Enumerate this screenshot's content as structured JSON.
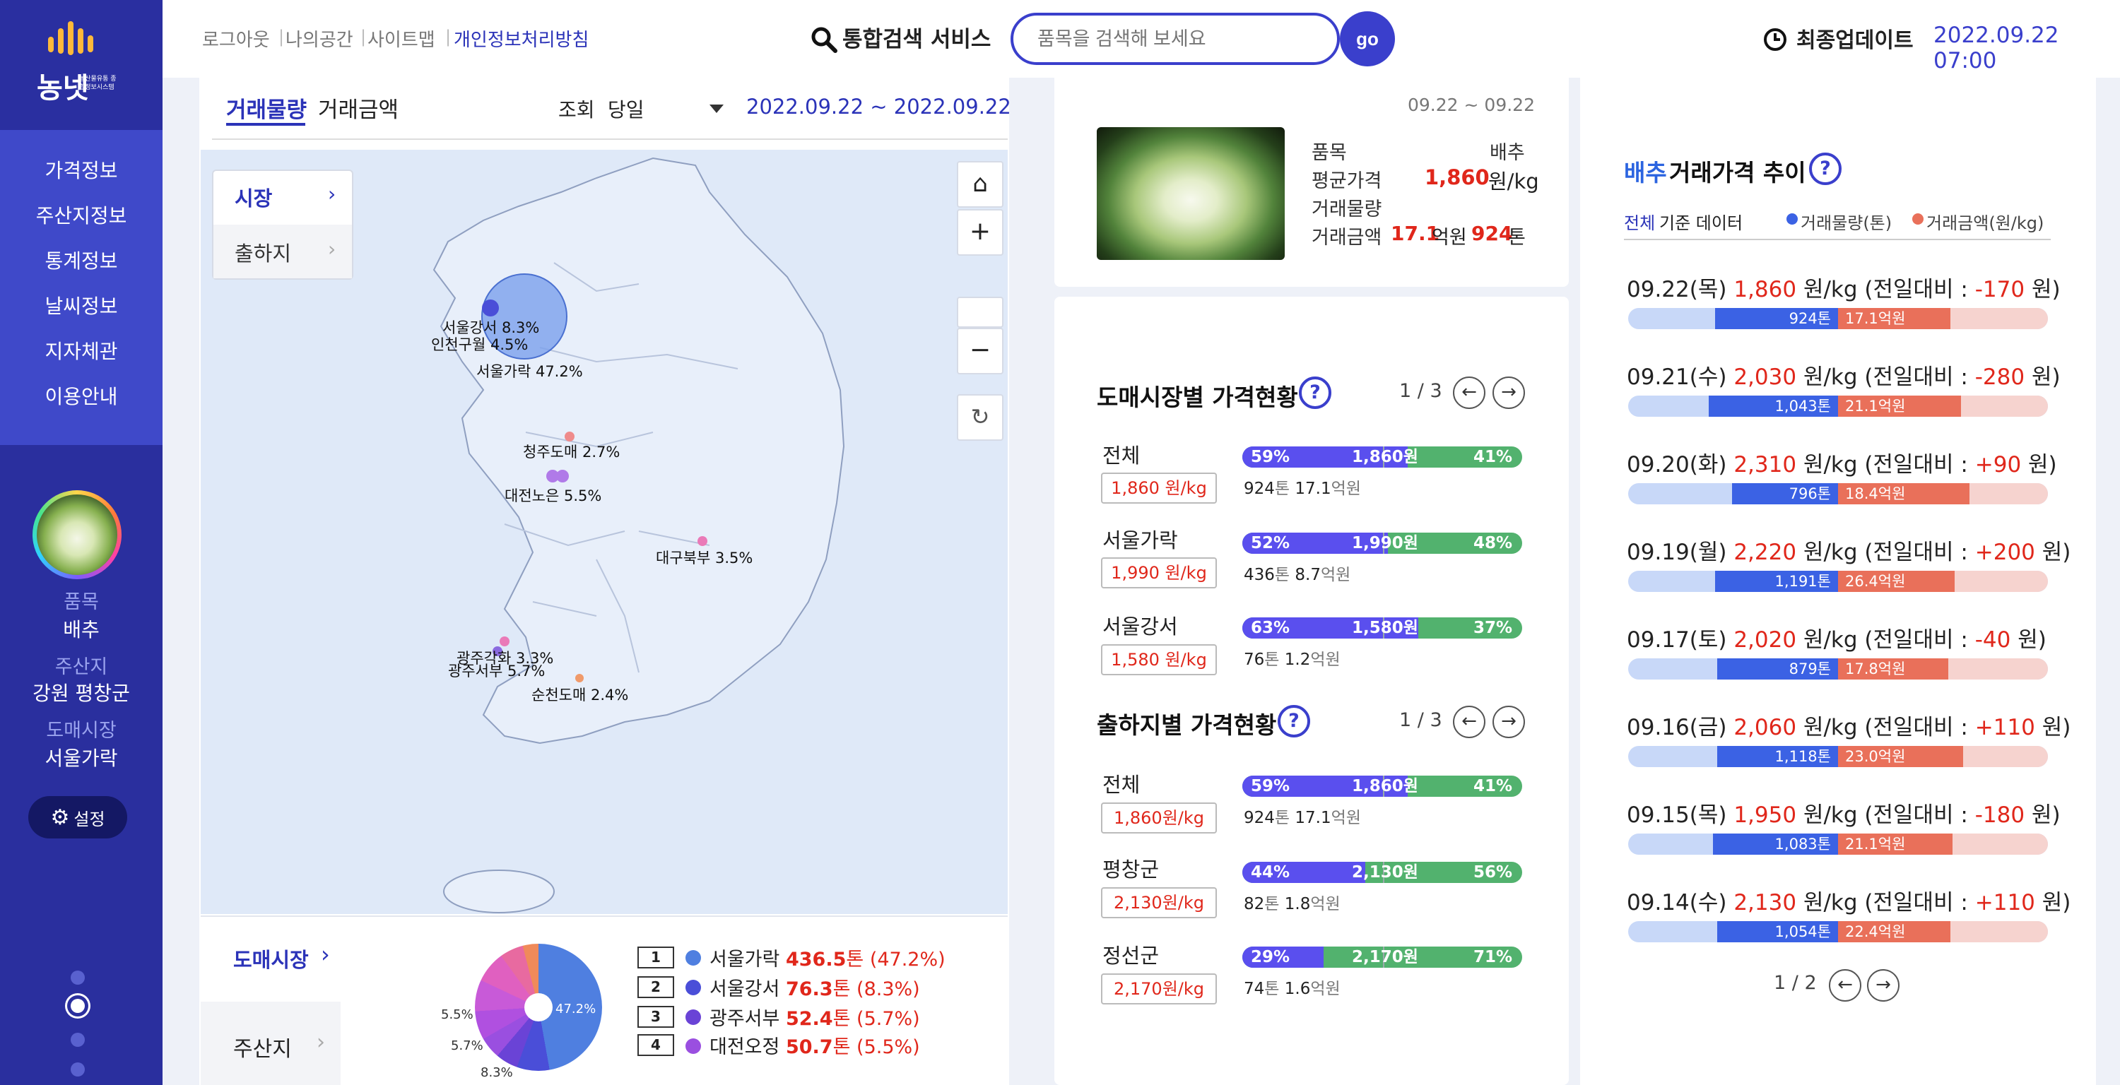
{
  "colors": {
    "primary": "#3a3fcc",
    "sidebar": "#3038b0",
    "price_red": "#e0271b",
    "bar_purple": "#5a4fee",
    "bar_green": "#52b26e",
    "vol_blue": "#3b62e4",
    "amt_red": "#e9705a"
  },
  "logo": {
    "text": "농넷",
    "sub": "농산물유통 종합정보시스템"
  },
  "sidebar": {
    "nav": [
      "가격정보",
      "주산지정보",
      "통계정보",
      "날씨정보",
      "지자체관",
      "이용안내"
    ],
    "profile": {
      "item_label": "품목",
      "item_value": "배추",
      "origin_label": "주산지",
      "origin_value": "강원 평창군",
      "market_label": "도매시장",
      "market_value": "서울가락"
    },
    "settings_label": "설정"
  },
  "header": {
    "links": [
      "로그아웃",
      "나의공간",
      "사이트맵",
      "개인정보처리방침"
    ],
    "search_label": "통합검색 서비스",
    "search_placeholder": "품목을 검색해 보세요",
    "go_label": "go",
    "update_label": "최종업데이트",
    "update_time": "2022.09.22 07:00"
  },
  "left": {
    "tabs": [
      "거래물량",
      "거래금액"
    ],
    "query_label": "조회",
    "query_value": "당일",
    "date_range": "2022.09.22 ~ 2022.09.22",
    "map_tabs": [
      "시장",
      "출하지"
    ],
    "map_labels": [
      "서울강서 8.3%",
      "인천구월 4.5%",
      "서울가락 47.2%",
      "청주도매 2.7%",
      "대전노은 5.5%",
      "대구북부 3.5%",
      "광주각화 3.3%",
      "광주서부 5.7%",
      "순천도매 2.4%"
    ],
    "bottom_tabs": [
      "도매시장",
      "주산지"
    ],
    "pie_labels": [
      "47.2%",
      "5.5%",
      "5.7%",
      "8.3%"
    ],
    "legend": [
      {
        "rank": "1",
        "name": "서울가락",
        "value": "436.5",
        "unit": "톤",
        "pct": "(47.2%)",
        "color": "#4f7fe0"
      },
      {
        "rank": "2",
        "name": "서울강서",
        "value": "76.3",
        "unit": "톤",
        "pct": "(8.3%)",
        "color": "#4a4ed8"
      },
      {
        "rank": "3",
        "name": "광주서부",
        "value": "52.4",
        "unit": "톤",
        "pct": "(5.7%)",
        "color": "#6a43d6"
      },
      {
        "rank": "4",
        "name": "대전오정",
        "value": "50.7",
        "unit": "톤",
        "pct": "(5.5%)",
        "color": "#9a4fe0"
      }
    ]
  },
  "summary": {
    "date": "09.22 ~ 09.22",
    "item_label": "품목",
    "item_value": "배추",
    "avg_label": "평균가격",
    "avg_value": "1,860",
    "avg_unit": "원/kg",
    "vol_label": "거래물량",
    "amt_label": "거래금액",
    "amt_value": "17.1",
    "amt_unit": "억원",
    "vol_value": "924",
    "vol_unit": "톤"
  },
  "markets": {
    "title": "도매시장별 가격현황",
    "page": "1 / 3",
    "rows": [
      {
        "name": "전체",
        "price": "1,860 원/kg",
        "left_pct": "59%",
        "right_pct": "41%",
        "mid": "1,860원",
        "fill": 0.59,
        "vol": "924",
        "amt": "17.1"
      },
      {
        "name": "서울가락",
        "price": "1,990 원/kg",
        "left_pct": "52%",
        "right_pct": "48%",
        "mid": "1,990원",
        "fill": 0.52,
        "vol": "436",
        "amt": "8.7"
      },
      {
        "name": "서울강서",
        "price": "1,580 원/kg",
        "left_pct": "63%",
        "right_pct": "37%",
        "mid": "1,580원",
        "fill": 0.63,
        "vol": "76",
        "amt": "1.2"
      }
    ]
  },
  "origins": {
    "title": "출하지별 가격현황",
    "page": "1 / 3",
    "rows": [
      {
        "name": "전체",
        "price": "1,860원/kg",
        "left_pct": "59%",
        "right_pct": "41%",
        "mid": "1,860원",
        "fill": 0.59,
        "vol": "924",
        "amt": "17.1"
      },
      {
        "name": "평창군",
        "price": "2,130원/kg",
        "left_pct": "44%",
        "right_pct": "56%",
        "mid": "2,130원",
        "fill": 0.44,
        "vol": "82",
        "amt": "1.8"
      },
      {
        "name": "정선군",
        "price": "2,170원/kg",
        "left_pct": "29%",
        "right_pct": "71%",
        "mid": "2,170원",
        "fill": 0.29,
        "vol": "74",
        "amt": "1.6"
      }
    ]
  },
  "units": {
    "ton": "톤",
    "eok": "억원"
  },
  "trend": {
    "title_item": "배추",
    "title_rest": "거래가격 추이",
    "sub_all": "전체",
    "sub_basis": "기준 데이터",
    "legend_vol": "거래물량(톤)",
    "legend_amt": "거래금액(원/kg)",
    "page": "1 / 2",
    "rows": [
      {
        "date": "09.22(목)",
        "price": "1,860",
        "unit": "원/kg",
        "diff_prefix": "(전일대비 :",
        "diff": "-170",
        "diff_suffix": "원)",
        "vol": "924톤",
        "amt": "17.1억원",
        "vol_ratio": 0.45,
        "amt_ratio": 0.4
      },
      {
        "date": "09.21(수)",
        "price": "2,030",
        "unit": "원/kg",
        "diff_prefix": "(전일대비 :",
        "diff": "-280",
        "diff_suffix": "원)",
        "vol": "1,043톤",
        "amt": "21.1억원",
        "vol_ratio": 0.48,
        "amt_ratio": 0.45
      },
      {
        "date": "09.20(화)",
        "price": "2,310",
        "unit": "원/kg",
        "diff_prefix": "(전일대비 :",
        "diff": "+90",
        "diff_suffix": "원)",
        "vol": "796톤",
        "amt": "18.4억원",
        "vol_ratio": 0.37,
        "amt_ratio": 0.49
      },
      {
        "date": "09.19(월)",
        "price": "2,220",
        "unit": "원/kg",
        "diff_prefix": "(전일대비 :",
        "diff": "+200",
        "diff_suffix": "원)",
        "vol": "1,191톤",
        "amt": "26.4억원",
        "vol_ratio": 0.45,
        "amt_ratio": 0.42
      },
      {
        "date": "09.17(토)",
        "price": "2,020",
        "unit": "원/kg",
        "diff_prefix": "(전일대비 :",
        "diff": "-40",
        "diff_suffix": "원)",
        "vol": "879톤",
        "amt": "17.8억원",
        "vol_ratio": 0.44,
        "amt_ratio": 0.39
      },
      {
        "date": "09.16(금)",
        "price": "2,060",
        "unit": "원/kg",
        "diff_prefix": "(전일대비 :",
        "diff": "+110",
        "diff_suffix": "원)",
        "vol": "1,118톤",
        "amt": "23.0억원",
        "vol_ratio": 0.44,
        "amt_ratio": 0.46
      },
      {
        "date": "09.15(목)",
        "price": "1,950",
        "unit": "원/kg",
        "diff_prefix": "(전일대비 :",
        "diff": "-180",
        "diff_suffix": "원)",
        "vol": "1,083톤",
        "amt": "21.1억원",
        "vol_ratio": 0.46,
        "amt_ratio": 0.41
      },
      {
        "date": "09.14(수)",
        "price": "2,130",
        "unit": "원/kg",
        "diff_prefix": "(전일대비 :",
        "diff": "+110",
        "diff_suffix": "원)",
        "vol": "1,054톤",
        "amt": "22.4억원",
        "vol_ratio": 0.44,
        "amt_ratio": 0.4
      }
    ]
  }
}
